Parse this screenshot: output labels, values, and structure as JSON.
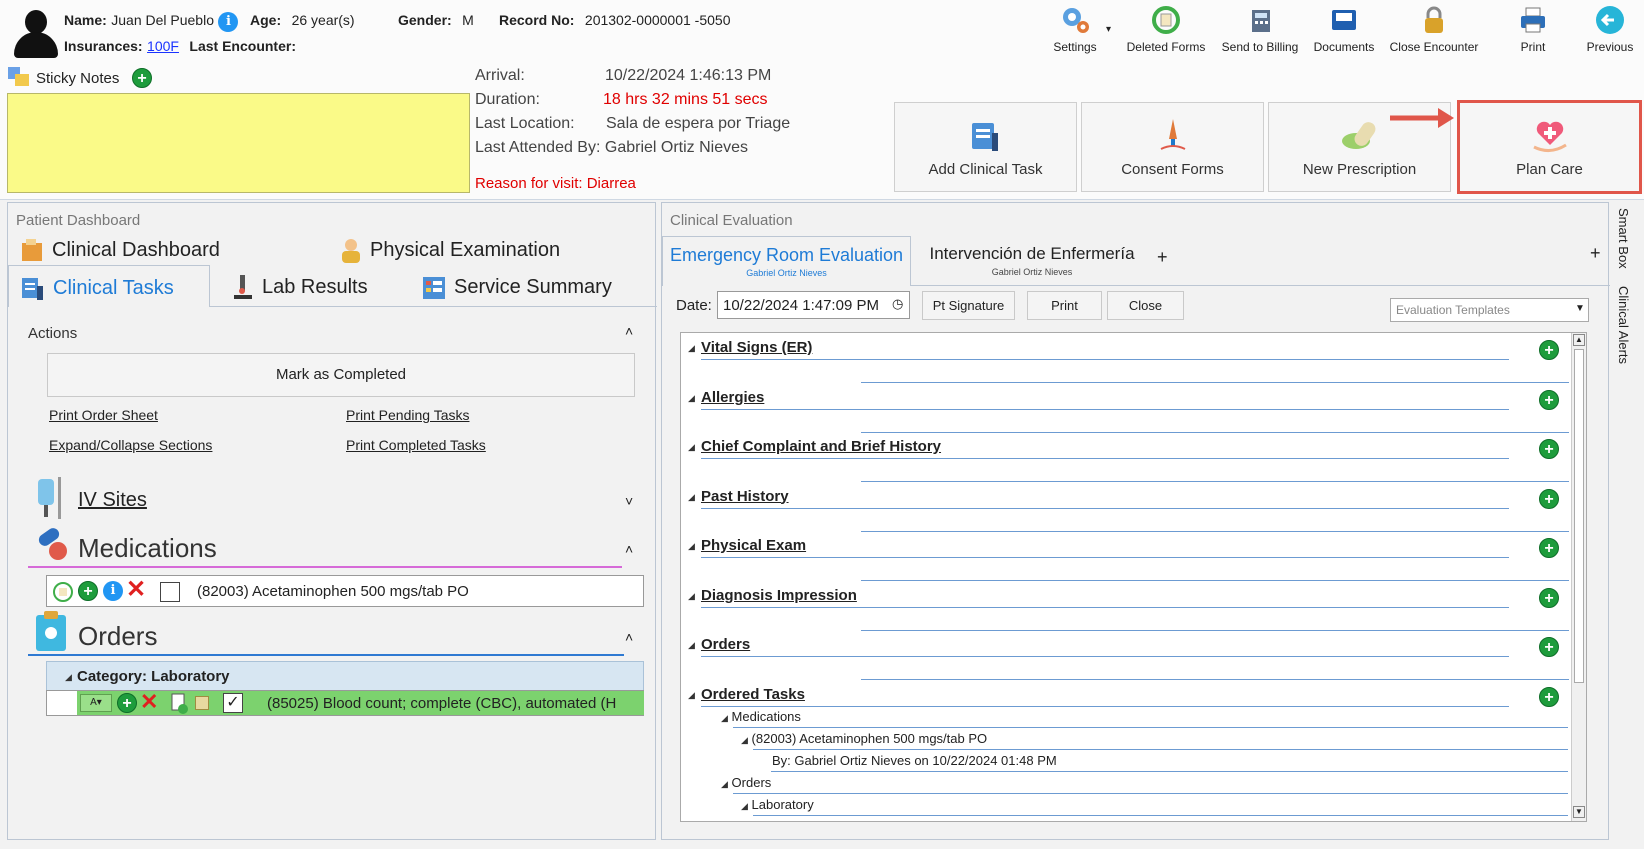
{
  "patient": {
    "name_label": "Name:",
    "name": "Juan Del Pueblo",
    "age_label": "Age:",
    "age": "26 year(s)",
    "gender_label": "Gender:",
    "gender": "M",
    "record_label": "Record No:",
    "record": "201302-0000001 -5050",
    "insurances_label": "Insurances:",
    "insurance": "100F",
    "last_encounter_label": "Last Encounter:"
  },
  "toolbar": {
    "settings": "Settings",
    "deleted_forms": "Deleted Forms",
    "send_to_billing": "Send to Billing",
    "documents": "Documents",
    "close_encounter": "Close Encounter",
    "print": "Print",
    "previous": "Previous"
  },
  "sticky": {
    "label": "Sticky Notes"
  },
  "visit": {
    "arrival_label": "Arrival:",
    "arrival": "10/22/2024 1:46:13 PM",
    "duration_label": "Duration:",
    "duration": "18 hrs 32 mins 51 secs",
    "last_location_label": "Last Location:",
    "last_location": "Sala de espera por Triage",
    "last_attended": "Last Attended By: Gabriel Ortiz Nieves",
    "reason": "Reason for visit: Diarrea"
  },
  "actions": {
    "add_clinical_task": "Add Clinical Task",
    "consent_forms": "Consent Forms",
    "new_prescription": "New Prescription",
    "plan_care": "Plan Care"
  },
  "dashboard": {
    "title": "Patient Dashboard",
    "tabs": {
      "clinical_dashboard": "Clinical Dashboard",
      "physical_examination": "Physical Examination",
      "clinical_tasks": "Clinical Tasks",
      "lab_results": "Lab Results",
      "service_summary": "Service Summary"
    },
    "actions_label": "Actions",
    "mark_completed": "Mark as Completed",
    "print_order_sheet": "Print Order Sheet",
    "print_pending": "Print Pending Tasks",
    "expand_collapse": "Expand/Collapse Sections",
    "print_completed": "Print Completed Tasks",
    "iv_sites": "IV Sites",
    "medications": "Medications",
    "medication_item": "(82003) Acetaminophen 500 mgs/tab PO",
    "orders": "Orders",
    "order_category": "Category: Laboratory",
    "order_item": "(85025) Blood count; complete (CBC), automated (H"
  },
  "evaluation": {
    "title": "Clinical Evaluation",
    "tab1": "Emergency Room Evaluation",
    "tab1_sub": "Gabriel Ortiz Nieves",
    "tab2": "Intervención de Enfermería",
    "tab2_sub": "Gabriel Ortiz Nieves",
    "add_tab": "+",
    "date_label": "Date:",
    "date_value": "10/22/2024 1:47:09 PM",
    "pt_signature": "Pt Signature",
    "print": "Print",
    "close": "Close",
    "templates_placeholder": "Evaluation Templates",
    "sections": [
      "Vital Signs (ER)",
      "Allergies",
      "Chief Complaint and Brief History",
      "Past History",
      "Physical Exam",
      "Diagnosis Impression",
      "Orders",
      "Ordered Tasks"
    ],
    "ordered": {
      "medications": "Medications",
      "med_item": "(82003) Acetaminophen 500 mgs/tab PO",
      "med_by": "By: Gabriel Ortiz Nieves on 10/22/2024 01:48 PM",
      "orders": "Orders",
      "laboratory": "Laboratory"
    }
  },
  "side": {
    "smart_box": "Smart Box",
    "clinical_alerts": "Clinical Alerts"
  }
}
